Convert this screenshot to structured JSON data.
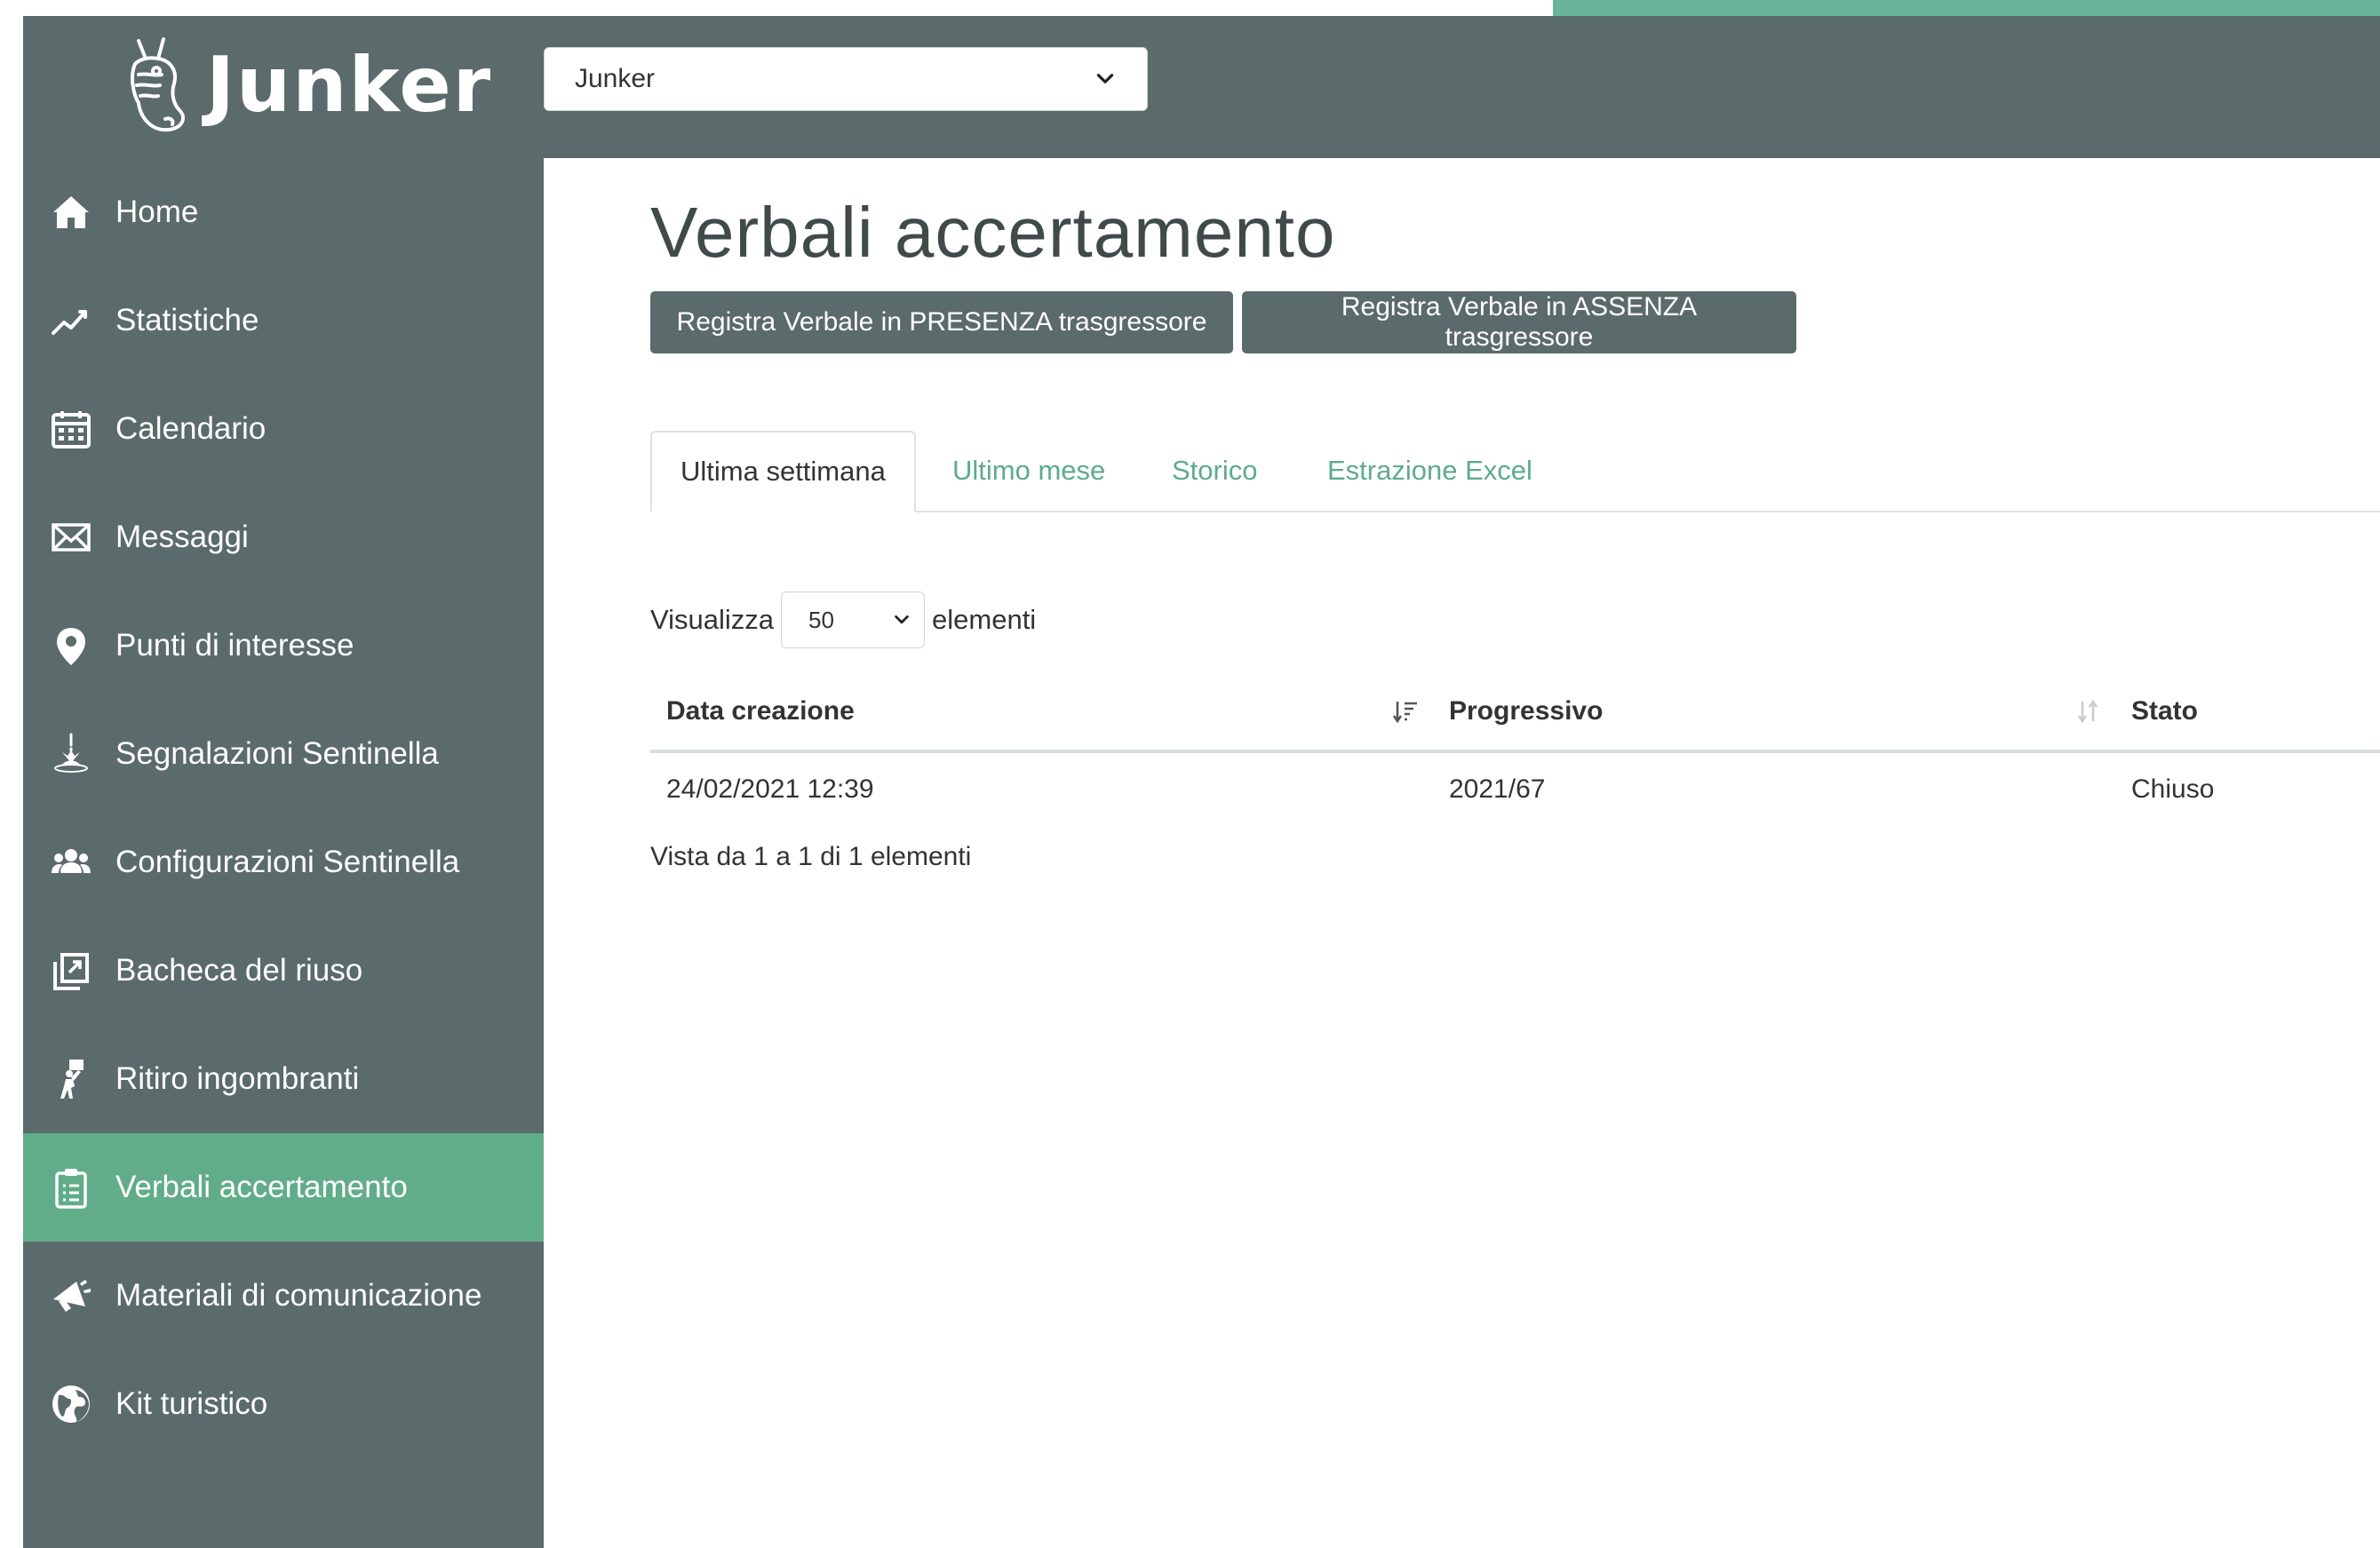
{
  "header": {
    "logo_text": "Junker",
    "org_select_value": "Junker"
  },
  "sidebar": {
    "items": [
      {
        "label": "Home",
        "icon": "home-icon"
      },
      {
        "label": "Statistiche",
        "icon": "chart-line-icon"
      },
      {
        "label": "Calendario",
        "icon": "calendar-icon"
      },
      {
        "label": "Messaggi",
        "icon": "envelope-icon"
      },
      {
        "label": "Punti di interesse",
        "icon": "map-pin-icon"
      },
      {
        "label": "Segnalazioni Sentinella",
        "icon": "sentinel-report-icon"
      },
      {
        "label": "Configurazioni Sentinella",
        "icon": "users-icon"
      },
      {
        "label": "Bacheca del riuso",
        "icon": "share-board-icon"
      },
      {
        "label": "Ritiro ingombranti",
        "icon": "person-carrying-icon"
      },
      {
        "label": "Verbali accertamento",
        "icon": "clipboard-list-icon",
        "active": true
      },
      {
        "label": "Materiali di comunicazione",
        "icon": "megaphone-icon"
      },
      {
        "label": "Kit turistico",
        "icon": "globe-icon"
      }
    ]
  },
  "main": {
    "title": "Verbali accertamento",
    "buttons": {
      "presenza": "Registra Verbale in PRESENZA trasgressore",
      "assenza": "Registra Verbale in ASSENZA trasgressore"
    },
    "tabs": [
      {
        "label": "Ultima settimana",
        "active": true
      },
      {
        "label": "Ultimo mese"
      },
      {
        "label": "Storico"
      },
      {
        "label": "Estrazione Excel"
      }
    ],
    "length_menu": {
      "prefix": "Visualizza",
      "value": "50",
      "suffix": "elementi"
    },
    "table": {
      "columns": [
        "Data creazione",
        "Progressivo",
        "Stato"
      ],
      "rows": [
        [
          "24/02/2021 12:39",
          "2021/67",
          "Chiuso"
        ]
      ]
    },
    "info": "Vista da 1 a 1 di 1 elementi"
  },
  "colors": {
    "sidebar_bg": "#5b6a6a",
    "accent_green": "#62ad89",
    "link_green": "#5eab8a"
  }
}
